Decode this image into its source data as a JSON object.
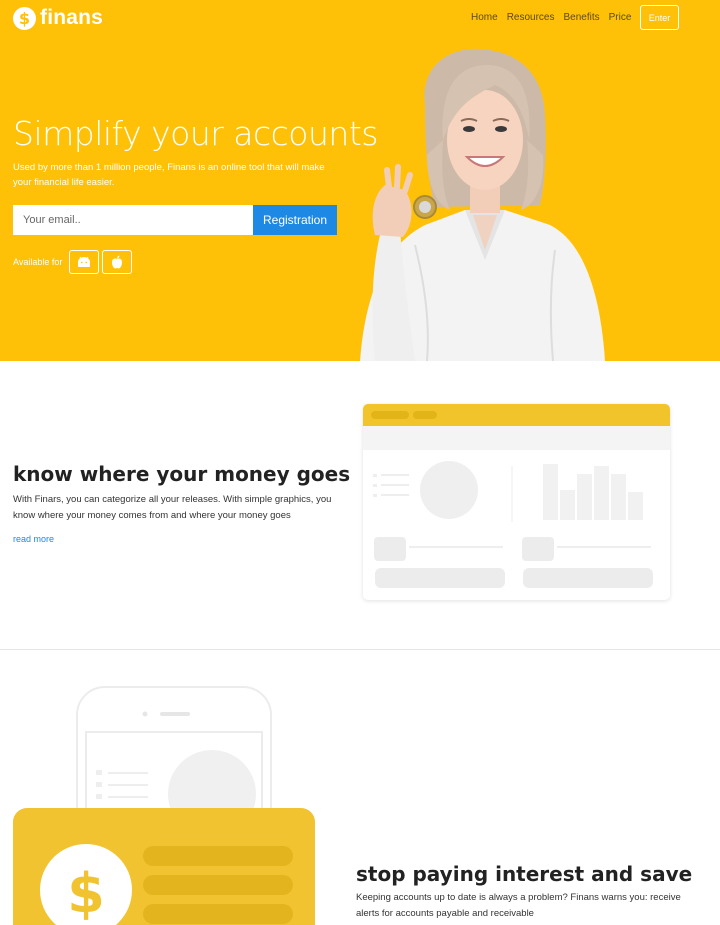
{
  "brand": {
    "name": "finans",
    "coin_symbol": "$",
    "color": "#ffc107"
  },
  "nav": {
    "items": [
      "Home",
      "Resources",
      "Benefits",
      "Price"
    ],
    "enter_label": "Enter"
  },
  "hero": {
    "title": "Simplify your accounts",
    "subtitle": "Used by more than 1 million people, Finans is an online tool that will make your financial life easier.",
    "email_placeholder": "Your email..",
    "register_label": "Registration",
    "register_color": "#1e88e5",
    "available_label": "Available for",
    "platforms": [
      "android-icon",
      "apple-icon"
    ]
  },
  "feature1": {
    "title": "know where your money goes",
    "text": "With Finars, you can categorize all your releases. With simple graphics, you know where your money comes from and where your money goes",
    "link": "read more"
  },
  "feature2": {
    "title": "stop paying interest and save",
    "text": "Keeping accounts up to date is always a problem? Finans warns you: receive alerts for accounts payable and receivable"
  }
}
